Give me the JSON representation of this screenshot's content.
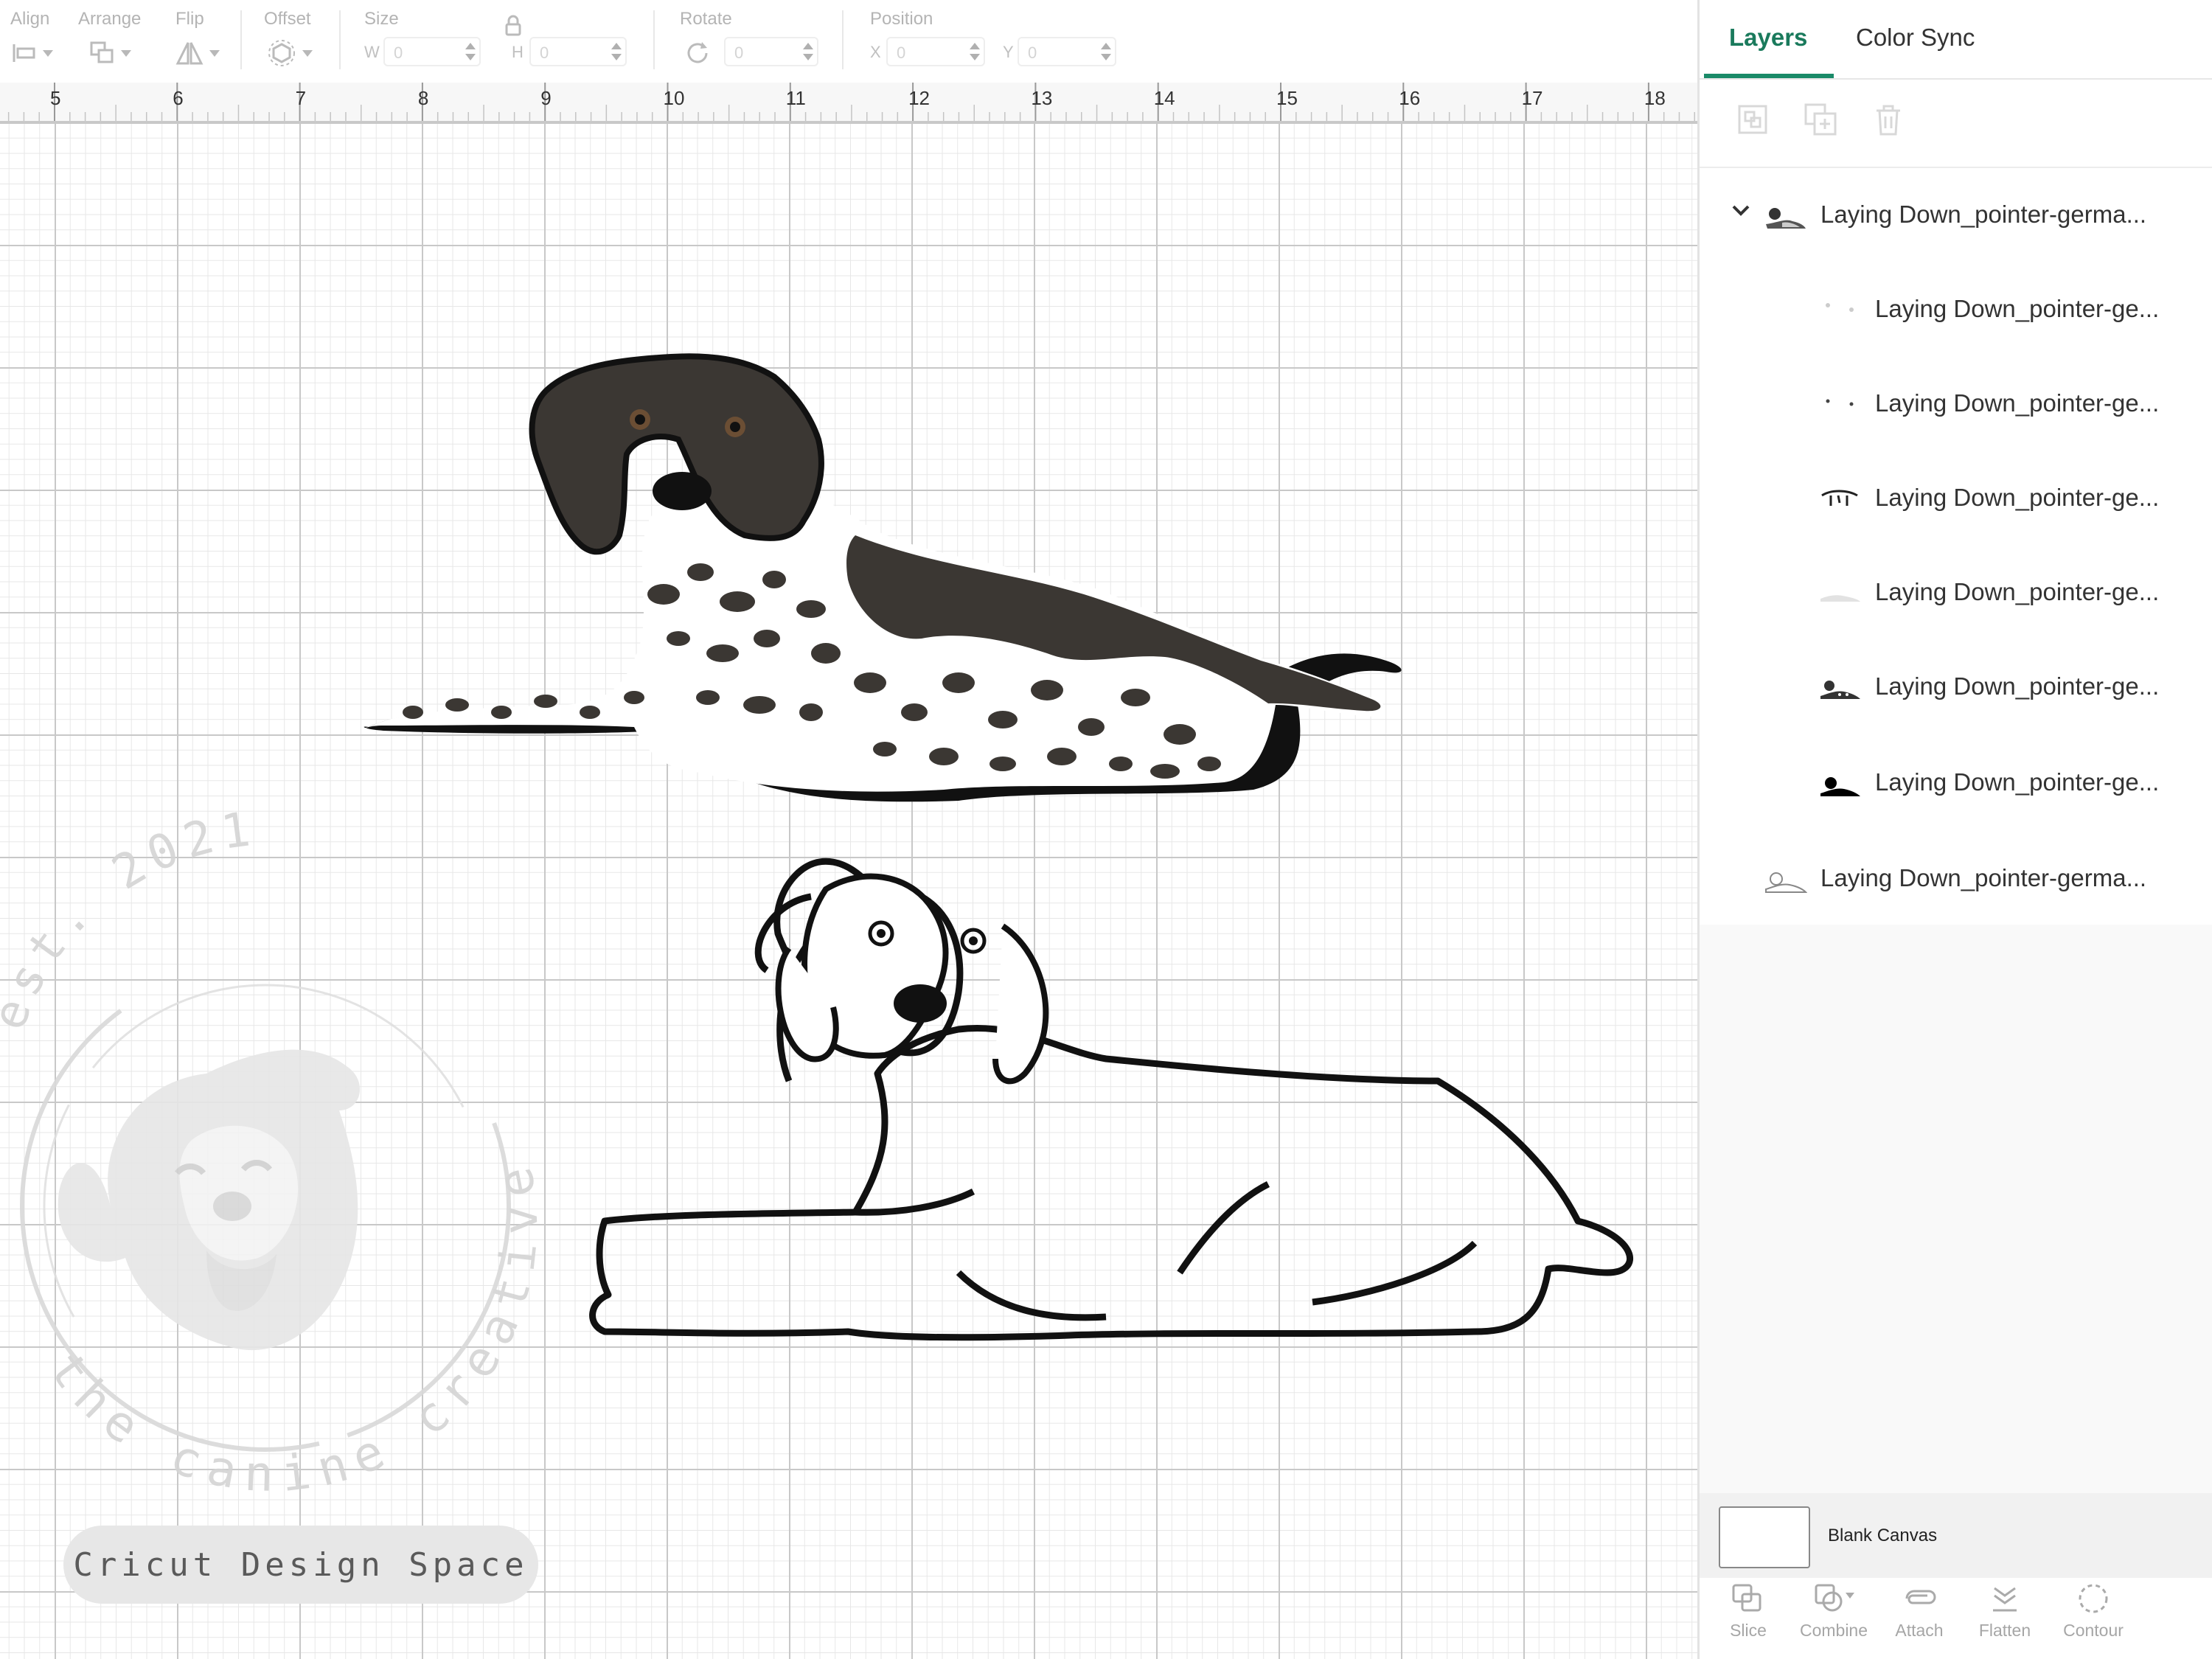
{
  "toolbar": {
    "align": "Align",
    "arrange": "Arrange",
    "flip": "Flip",
    "offset": "Offset",
    "size": "Size",
    "w_label": "W",
    "w_value": "0",
    "h_label": "H",
    "h_value": "0",
    "rotate": "Rotate",
    "rotate_value": "0",
    "position": "Position",
    "x_label": "X",
    "x_value": "0",
    "y_label": "Y",
    "y_value": "0"
  },
  "ruler": {
    "numbers": [
      "5",
      "6",
      "7",
      "8",
      "9",
      "10",
      "11",
      "12",
      "13",
      "14",
      "15",
      "16",
      "17",
      "18"
    ]
  },
  "canvas": {
    "badge": "Cricut Design Space",
    "watermark": {
      "est": "est. 2021",
      "brand": "the canine creative"
    }
  },
  "panel": {
    "tabs": [
      {
        "label": "Layers",
        "active": true
      },
      {
        "label": "Color Sync",
        "active": false
      }
    ],
    "layers": [
      {
        "name": "Laying Down_pointer-germa...",
        "thumb": "dog-colored-icon"
      },
      {
        "name": "Laying Down_pointer-ge...",
        "thumb": "eyes-highlight-icon"
      },
      {
        "name": "Laying Down_pointer-ge...",
        "thumb": "eye-dots-icon"
      },
      {
        "name": "Laying Down_pointer-ge...",
        "thumb": "face-detail-icon"
      },
      {
        "name": "Laying Down_pointer-ge...",
        "thumb": "white-body-icon"
      },
      {
        "name": "Laying Down_pointer-ge...",
        "thumb": "spots-icon"
      },
      {
        "name": "Laying Down_pointer-ge...",
        "thumb": "black-outline-icon"
      },
      {
        "name": "Laying Down_pointer-germa...",
        "thumb": "dog-outline-icon"
      }
    ],
    "blank_canvas": "Blank Canvas",
    "bottom_tools": [
      "Slice",
      "Combine",
      "Attach",
      "Flatten",
      "Contour"
    ]
  },
  "colors": {
    "accent": "#1a8a68",
    "dog_dark": "#3b3733",
    "grid_major": "#c8c8c8"
  }
}
